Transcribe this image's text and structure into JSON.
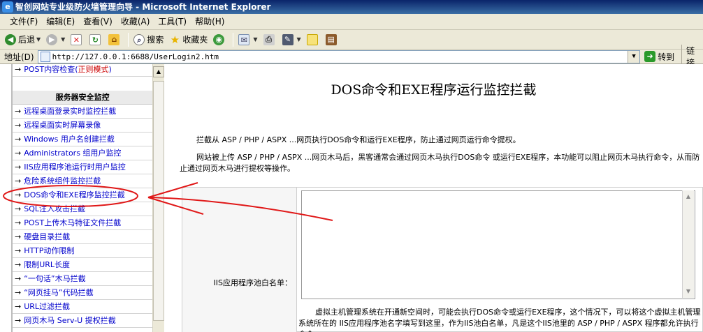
{
  "window": {
    "title": "智创网站专业级防火墙管理向导 - Microsoft Internet Explorer"
  },
  "menu": {
    "items": [
      "文件(F)",
      "编辑(E)",
      "查看(V)",
      "收藏(A)",
      "工具(T)",
      "帮助(H)"
    ]
  },
  "toolbar": {
    "back": "后退",
    "search": "搜索",
    "favorites": "收藏夹"
  },
  "address": {
    "label": "地址(D)",
    "url": "http://127.0.0.1:6688/UserLogin2.htm",
    "go": "转到",
    "links": "链接"
  },
  "sidebar": {
    "top_item": {
      "text": "POST内容检查(",
      "mode": "正则模式",
      "close": ")"
    },
    "section_title": "服务器安全监控",
    "items": [
      "远程桌面登录实时监控拦截",
      "远程桌面实时屏幕录像",
      "Windows 用户名创建拦截",
      "Administrators 组用户监控",
      "IIS应用程序池运行时用户监控",
      "危险系统组件监控拦截",
      "DOS命令和EXE程序监控拦截",
      "SQL注入攻击拦截",
      "POST上传木马特征文件拦截",
      "硬盘目录拦截",
      "HTTP动作限制",
      "限制URL长度",
      "“一句话”木马拦截",
      "“网页挂马”代码拦截",
      "URL过滤拦截",
      "网页木马 Serv-U 提权拦截"
    ],
    "arrow": "→"
  },
  "content": {
    "heading": "DOS命令和EXE程序运行监控拦截",
    "para1": "拦截从 ASP / PHP / ASPX ...网页执行DOS命令和运行EXE程序，防止通过网页运行命令提权。",
    "para2": "网站被上传 ASP / PHP / ASPX ...网页木马后，黑客通常会通过网页木马执行DOS命令 或运行EXE程序，本功能可以阻止网页木马执行命令，从而防止通过网页木马进行提权等操作。",
    "whitelist_label": "IIS应用程序池白名单：",
    "whitelist_value": "",
    "note": "虚拟主机管理系统在开通新空间时，可能会执行DOS命令或运行EXE程序，这个情况下，可以将这个虚拟主机管理系统所在的 IIS应用程序池名字填写到这里，作为IIS池白名单，凡是这个IIS池里的 ASP / PHP / ASPX 程序都允许执行命令。"
  },
  "annotation": {
    "color": "#e01818",
    "highlighted_item": "DOS命令和EXE程序监控拦截"
  }
}
